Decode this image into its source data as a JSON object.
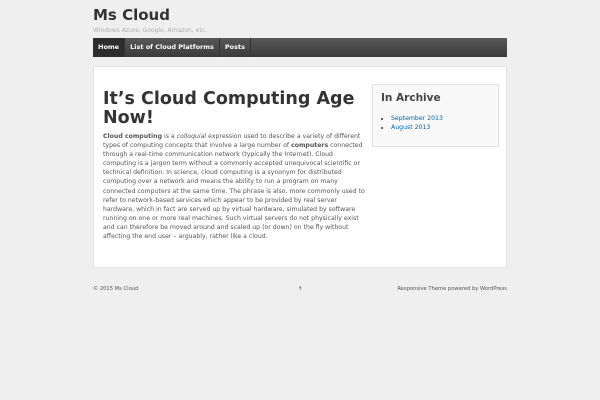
{
  "site": {
    "title": "Ms Cloud",
    "tagline": "Windows Azure, Google, Amazon, etc."
  },
  "nav": {
    "items": [
      {
        "label": "Home",
        "active": true
      },
      {
        "label": "List of Cloud Platforms",
        "active": false
      },
      {
        "label": "Posts",
        "active": false
      }
    ]
  },
  "post": {
    "title": "It’s Cloud Computing Age Now!",
    "body": {
      "term1": "Cloud computing",
      "seg1": " is a ",
      "colloquial": "colloquial",
      "seg2": " expression used to describe a variety of different types of computing concepts that involve a large number of ",
      "term2": "computers",
      "seg3": " connected through a real-time communication network (typically the Internet). Cloud computing is a jargon term without a commonly accepted unequivocal scientific or technical definition. In science, cloud computing is a synonym for distributed computing over a network and means the ability to run a program on many connected computers at the same time. The phrase is also, more commonly used to refer to network-based services which appear to be provided by real server hardware, which in fact are served up by virtual hardware, simulated by software running on one or more real machines. Such virtual servers do not physically exist and can therefore be moved around and scaled up (or down) on the fly without affecting the end user – arguably, rather like a cloud."
    }
  },
  "sidebar": {
    "title": "In Archive",
    "items": [
      {
        "label": "September 2013"
      },
      {
        "label": "August 2013"
      }
    ]
  },
  "footer": {
    "copyright": "© 2015 Ms Cloud",
    "top_link": "↑",
    "theme_link": "Responsive Theme",
    "powered_by": " powered by ",
    "wordpress_link": "WordPress"
  },
  "colors": {
    "link": "#0066aa",
    "nav_bg": "#4a4a4a",
    "page_bg": "#efefef"
  }
}
